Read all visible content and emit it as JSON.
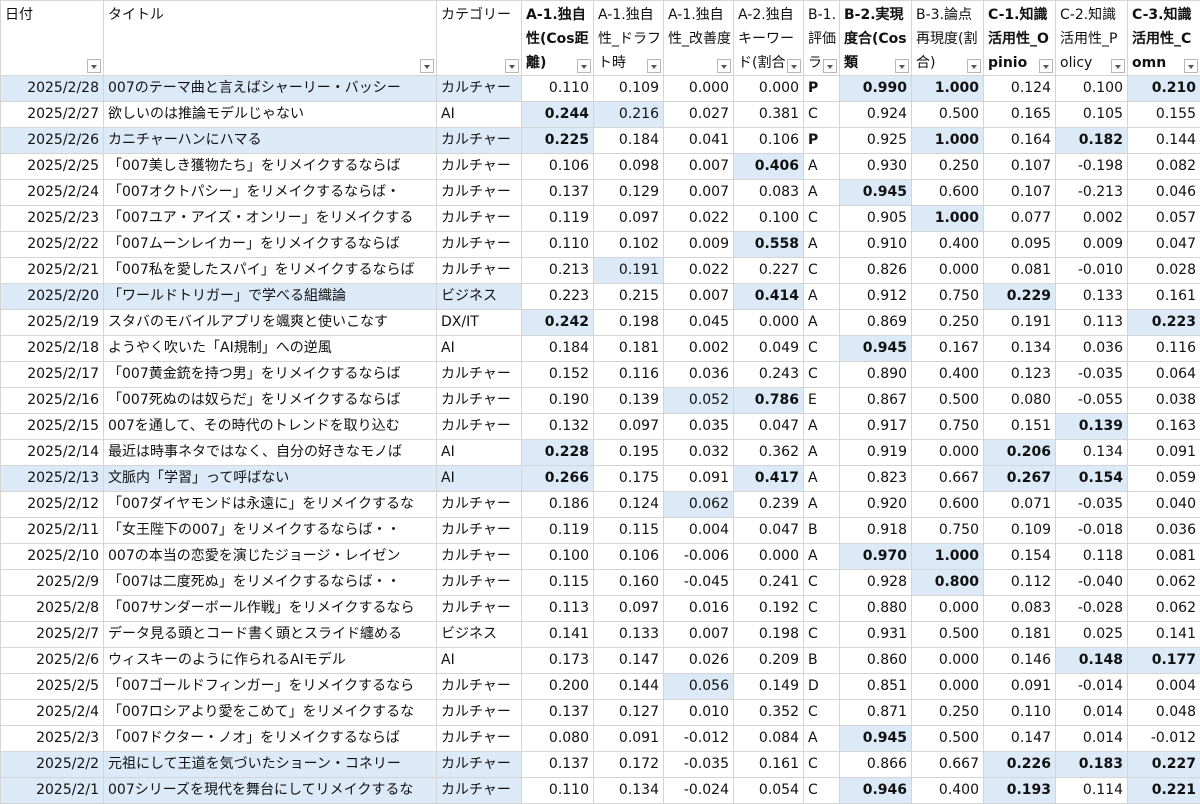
{
  "headers": [
    {
      "label": "日付",
      "bold": false
    },
    {
      "label": "タイトル",
      "bold": false
    },
    {
      "label": "カテゴリー",
      "bold": false
    },
    {
      "label": "A-1.独自性(Cos距離)",
      "bold": true
    },
    {
      "label": "A-1.独自性_ドラフト時",
      "bold": false
    },
    {
      "label": "A-1.独自性_改善度",
      "bold": false
    },
    {
      "label": "A-2.独自キーワード(割合",
      "bold": false
    },
    {
      "label": "B-1.評価ラ",
      "bold": false
    },
    {
      "label": "B-2.実現度合(Cos類",
      "bold": true
    },
    {
      "label": "B-3.論点再現度(割合)",
      "bold": false
    },
    {
      "label": "C-1.知識活用性_Opinio",
      "bold": true
    },
    {
      "label": "C-2.知識活用性_Policy",
      "bold": false
    },
    {
      "label": "C-3.知識活用性_Comn",
      "bold": true
    }
  ],
  "rows": [
    {
      "date": "2025/2/28",
      "title": "007のテーマ曲と言えばシャーリー・バッシー",
      "cat": "カルチャー",
      "a1": "0.110",
      "a1d": "0.109",
      "a1i": "0.000",
      "a2": "0.000",
      "b1": "P",
      "b2": "0.990",
      "b3": "1.000",
      "c1": "0.124",
      "c2": "0.100",
      "c3": "0.210"
    },
    {
      "date": "2025/2/27",
      "title": "欲しいのは推論モデルじゃない",
      "cat": "AI",
      "a1": "0.244",
      "a1d": "0.216",
      "a1i": "0.027",
      "a2": "0.381",
      "b1": "C",
      "b2": "0.924",
      "b3": "0.500",
      "c1": "0.165",
      "c2": "0.105",
      "c3": "0.155"
    },
    {
      "date": "2025/2/26",
      "title": "カニチャーハンにハマる",
      "cat": "カルチャー",
      "a1": "0.225",
      "a1d": "0.184",
      "a1i": "0.041",
      "a2": "0.106",
      "b1": "P",
      "b2": "0.925",
      "b3": "1.000",
      "c1": "0.164",
      "c2": "0.182",
      "c3": "0.144"
    },
    {
      "date": "2025/2/25",
      "title": "「007美しき獲物たち」をリメイクするならば",
      "cat": "カルチャー",
      "a1": "0.106",
      "a1d": "0.098",
      "a1i": "0.007",
      "a2": "0.406",
      "b1": "A",
      "b2": "0.930",
      "b3": "0.250",
      "c1": "0.107",
      "c2": "-0.198",
      "c3": "0.082"
    },
    {
      "date": "2025/2/24",
      "title": "「007オクトパシー」をリメイクするならば・",
      "cat": "カルチャー",
      "a1": "0.137",
      "a1d": "0.129",
      "a1i": "0.007",
      "a2": "0.083",
      "b1": "A",
      "b2": "0.945",
      "b3": "0.600",
      "c1": "0.107",
      "c2": "-0.213",
      "c3": "0.046"
    },
    {
      "date": "2025/2/23",
      "title": "「007ユア・アイズ・オンリー」をリメイクする",
      "cat": "カルチャー",
      "a1": "0.119",
      "a1d": "0.097",
      "a1i": "0.022",
      "a2": "0.100",
      "b1": "C",
      "b2": "0.905",
      "b3": "1.000",
      "c1": "0.077",
      "c2": "0.002",
      "c3": "0.057"
    },
    {
      "date": "2025/2/22",
      "title": "「007ムーンレイカー」をリメイクするならば",
      "cat": "カルチャー",
      "a1": "0.110",
      "a1d": "0.102",
      "a1i": "0.009",
      "a2": "0.558",
      "b1": "A",
      "b2": "0.910",
      "b3": "0.400",
      "c1": "0.095",
      "c2": "0.009",
      "c3": "0.047"
    },
    {
      "date": "2025/2/21",
      "title": "「007私を愛したスパイ」をリメイクするならば",
      "cat": "カルチャー",
      "a1": "0.213",
      "a1d": "0.191",
      "a1i": "0.022",
      "a2": "0.227",
      "b1": "C",
      "b2": "0.826",
      "b3": "0.000",
      "c1": "0.081",
      "c2": "-0.010",
      "c3": "0.028"
    },
    {
      "date": "2025/2/20",
      "title": "「ワールドトリガー」で学べる組織論",
      "cat": "ビジネス",
      "a1": "0.223",
      "a1d": "0.215",
      "a1i": "0.007",
      "a2": "0.414",
      "b1": "A",
      "b2": "0.912",
      "b3": "0.750",
      "c1": "0.229",
      "c2": "0.133",
      "c3": "0.161"
    },
    {
      "date": "2025/2/19",
      "title": "スタバのモバイルアプリを颯爽と使いこなす",
      "cat": "DX/IT",
      "a1": "0.242",
      "a1d": "0.198",
      "a1i": "0.045",
      "a2": "0.000",
      "b1": "A",
      "b2": "0.869",
      "b3": "0.250",
      "c1": "0.191",
      "c2": "0.113",
      "c3": "0.223"
    },
    {
      "date": "2025/2/18",
      "title": "ようやく吹いた「AI規制」への逆風",
      "cat": "AI",
      "a1": "0.184",
      "a1d": "0.181",
      "a1i": "0.002",
      "a2": "0.049",
      "b1": "C",
      "b2": "0.945",
      "b3": "0.167",
      "c1": "0.134",
      "c2": "0.036",
      "c3": "0.116"
    },
    {
      "date": "2025/2/17",
      "title": "「007黄金銃を持つ男」をリメイクするならば",
      "cat": "カルチャー",
      "a1": "0.152",
      "a1d": "0.116",
      "a1i": "0.036",
      "a2": "0.243",
      "b1": "C",
      "b2": "0.890",
      "b3": "0.400",
      "c1": "0.123",
      "c2": "-0.035",
      "c3": "0.064"
    },
    {
      "date": "2025/2/16",
      "title": "「007死ぬのは奴らだ」をリメイクするならば",
      "cat": "カルチャー",
      "a1": "0.190",
      "a1d": "0.139",
      "a1i": "0.052",
      "a2": "0.786",
      "b1": "E",
      "b2": "0.867",
      "b3": "0.500",
      "c1": "0.080",
      "c2": "-0.055",
      "c3": "0.038"
    },
    {
      "date": "2025/2/15",
      "title": "007を通して、その時代のトレンドを取り込む",
      "cat": "カルチャー",
      "a1": "0.132",
      "a1d": "0.097",
      "a1i": "0.035",
      "a2": "0.047",
      "b1": "A",
      "b2": "0.917",
      "b3": "0.750",
      "c1": "0.151",
      "c2": "0.139",
      "c3": "0.163"
    },
    {
      "date": "2025/2/14",
      "title": "最近は時事ネタではなく、自分の好きなモノば",
      "cat": "AI",
      "a1": "0.228",
      "a1d": "0.195",
      "a1i": "0.032",
      "a2": "0.362",
      "b1": "A",
      "b2": "0.919",
      "b3": "0.000",
      "c1": "0.206",
      "c2": "0.134",
      "c3": "0.091"
    },
    {
      "date": "2025/2/13",
      "title": "文脈内「学習」って呼ばない",
      "cat": "AI",
      "a1": "0.266",
      "a1d": "0.175",
      "a1i": "0.091",
      "a2": "0.417",
      "b1": "A",
      "b2": "0.823",
      "b3": "0.667",
      "c1": "0.267",
      "c2": "0.154",
      "c3": "0.059"
    },
    {
      "date": "2025/2/12",
      "title": "「007ダイヤモンドは永遠に」をリメイクするな",
      "cat": "カルチャー",
      "a1": "0.186",
      "a1d": "0.124",
      "a1i": "0.062",
      "a2": "0.239",
      "b1": "A",
      "b2": "0.920",
      "b3": "0.600",
      "c1": "0.071",
      "c2": "-0.035",
      "c3": "0.040"
    },
    {
      "date": "2025/2/11",
      "title": "「女王陛下の007」をリメイクするならば・・",
      "cat": "カルチャー",
      "a1": "0.119",
      "a1d": "0.115",
      "a1i": "0.004",
      "a2": "0.047",
      "b1": "B",
      "b2": "0.918",
      "b3": "0.750",
      "c1": "0.109",
      "c2": "-0.018",
      "c3": "0.036"
    },
    {
      "date": "2025/2/10",
      "title": "007の本当の恋愛を演じたジョージ・レイゼン",
      "cat": "カルチャー",
      "a1": "0.100",
      "a1d": "0.106",
      "a1i": "-0.006",
      "a2": "0.000",
      "b1": "A",
      "b2": "0.970",
      "b3": "1.000",
      "c1": "0.154",
      "c2": "0.118",
      "c3": "0.081"
    },
    {
      "date": "2025/2/9",
      "title": "「007は二度死ぬ」をリメイクするならば・・",
      "cat": "カルチャー",
      "a1": "0.115",
      "a1d": "0.160",
      "a1i": "-0.045",
      "a2": "0.241",
      "b1": "C",
      "b2": "0.928",
      "b3": "0.800",
      "c1": "0.112",
      "c2": "-0.040",
      "c3": "0.062"
    },
    {
      "date": "2025/2/8",
      "title": "「007サンダーボール作戦」をリメイクするなら",
      "cat": "カルチャー",
      "a1": "0.113",
      "a1d": "0.097",
      "a1i": "0.016",
      "a2": "0.192",
      "b1": "C",
      "b2": "0.880",
      "b3": "0.000",
      "c1": "0.083",
      "c2": "-0.028",
      "c3": "0.062"
    },
    {
      "date": "2025/2/7",
      "title": "データ見る頭とコード書く頭とスライド纏める",
      "cat": "ビジネス",
      "a1": "0.141",
      "a1d": "0.133",
      "a1i": "0.007",
      "a2": "0.198",
      "b1": "C",
      "b2": "0.931",
      "b3": "0.500",
      "c1": "0.181",
      "c2": "0.025",
      "c3": "0.141"
    },
    {
      "date": "2025/2/6",
      "title": "ウィスキーのように作られるAIモデル",
      "cat": "AI",
      "a1": "0.173",
      "a1d": "0.147",
      "a1i": "0.026",
      "a2": "0.209",
      "b1": "B",
      "b2": "0.860",
      "b3": "0.000",
      "c1": "0.146",
      "c2": "0.148",
      "c3": "0.177"
    },
    {
      "date": "2025/2/5",
      "title": "「007ゴールドフィンガー」をリメイクするなら",
      "cat": "カルチャー",
      "a1": "0.200",
      "a1d": "0.144",
      "a1i": "0.056",
      "a2": "0.149",
      "b1": "D",
      "b2": "0.851",
      "b3": "0.000",
      "c1": "0.091",
      "c2": "-0.014",
      "c3": "0.004"
    },
    {
      "date": "2025/2/4",
      "title": "「007ロシアより愛をこめて」をリメイクするな",
      "cat": "カルチャー",
      "a1": "0.137",
      "a1d": "0.127",
      "a1i": "0.010",
      "a2": "0.352",
      "b1": "C",
      "b2": "0.871",
      "b3": "0.250",
      "c1": "0.110",
      "c2": "0.014",
      "c3": "0.048"
    },
    {
      "date": "2025/2/3",
      "title": "「007ドクター・ノオ」をリメイクするならば",
      "cat": "カルチャー",
      "a1": "0.080",
      "a1d": "0.091",
      "a1i": "-0.012",
      "a2": "0.084",
      "b1": "A",
      "b2": "0.945",
      "b3": "0.500",
      "c1": "0.147",
      "c2": "0.014",
      "c3": "-0.012"
    },
    {
      "date": "2025/2/2",
      "title": "元祖にして王道を気づいたショーン・コネリー",
      "cat": "カルチャー",
      "a1": "0.137",
      "a1d": "0.172",
      "a1i": "-0.035",
      "a2": "0.161",
      "b1": "C",
      "b2": "0.866",
      "b3": "0.667",
      "c1": "0.226",
      "c2": "0.183",
      "c3": "0.227"
    },
    {
      "date": "2025/2/1",
      "title": "007シリーズを現代を舞台にしてリメイクするな",
      "cat": "カルチャー",
      "a1": "0.110",
      "a1d": "0.134",
      "a1i": "-0.024",
      "a2": "0.054",
      "b1": "C",
      "b2": "0.946",
      "b3": "0.400",
      "c1": "0.193",
      "c2": "0.114",
      "c3": "0.221"
    }
  ]
}
